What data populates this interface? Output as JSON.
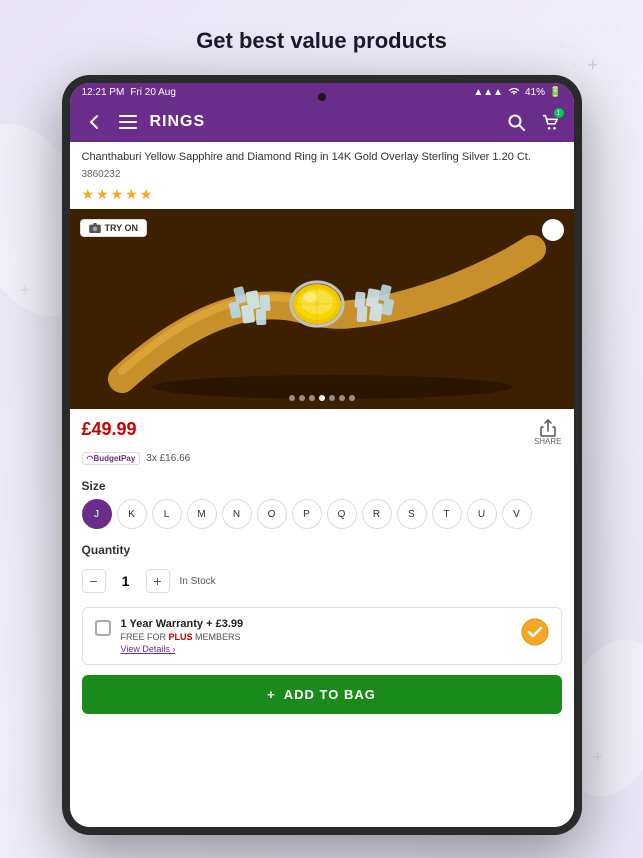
{
  "page": {
    "title": "Get best value products",
    "background_color": "#e8e4f5"
  },
  "status_bar": {
    "time": "12:21 PM",
    "date": "Fri 20 Aug",
    "battery": "41%",
    "signal_icon": "●●●",
    "wifi_icon": "wifi"
  },
  "nav": {
    "title": "RINGS",
    "back_icon": "back-arrow",
    "menu_icon": "hamburger",
    "search_icon": "search",
    "cart_icon": "shopping-bag",
    "cart_badge": "1"
  },
  "product": {
    "title": "Chanthaburi Yellow Sapphire and Diamond Ring in 14K Gold Overlay Sterling Silver 1.20 Ct.",
    "id": "3860232",
    "rating": 5,
    "rating_stars": "★★★★★",
    "price": "£49.99",
    "budget_pay_label": "3x £16.66",
    "budget_pay_logo": "BudgetPay",
    "share_label": "SHARE",
    "try_on_label": "TRY ON",
    "image_dots_count": 7,
    "active_dot": 4
  },
  "size": {
    "label": "Size",
    "options": [
      "J",
      "K",
      "L",
      "M",
      "N",
      "O",
      "P",
      "Q",
      "R",
      "S",
      "T",
      "U",
      "V"
    ],
    "selected": "J"
  },
  "quantity": {
    "label": "Quantity",
    "value": 1,
    "min": 1,
    "stock_status": "In Stock"
  },
  "warranty": {
    "title": "1 Year Warranty + £3.99",
    "subtitle": "FREE FOR PLUS MEMBERS",
    "plus_label": "PLUS",
    "link_text": "View Details ›",
    "checked": false
  },
  "add_to_bag": {
    "label": "ADD TO BAG",
    "plus_icon": "+"
  }
}
